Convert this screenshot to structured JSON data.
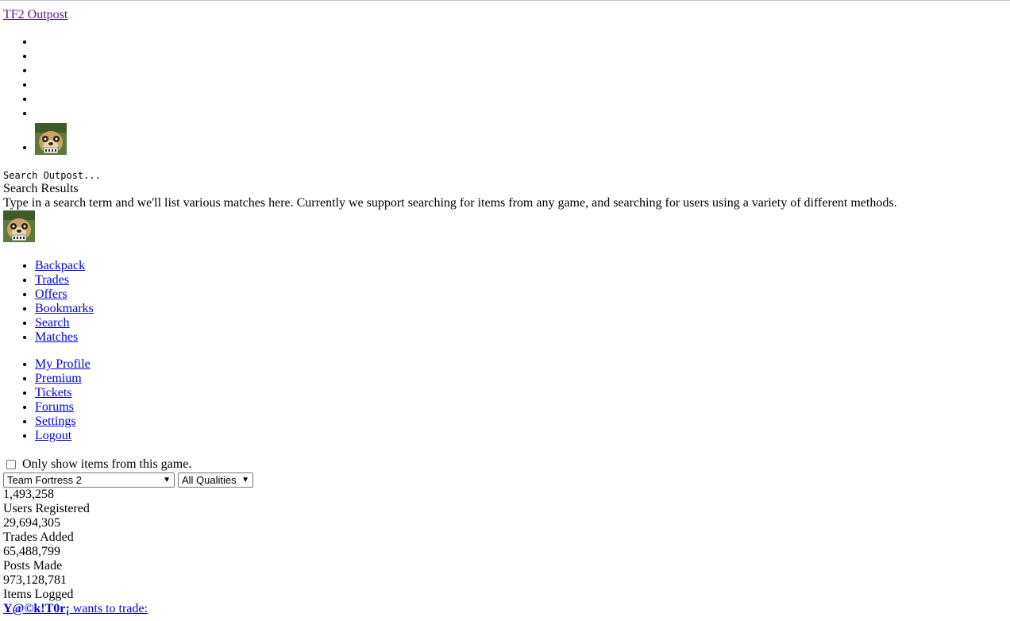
{
  "site": {
    "brand": "TF2 Outpost"
  },
  "search": {
    "label": "Search Outpost...",
    "results_title": "Search Results",
    "description": "Type in a search term and we'll list various matches here. Currently we support searching for items from any game, and searching for users using a variety of different methods."
  },
  "nav_main": [
    "Backpack",
    "Trades",
    "Offers",
    "Bookmarks",
    "Search",
    "Matches"
  ],
  "nav_account": [
    "My Profile",
    "Premium",
    "Tickets",
    "Forums",
    "Settings",
    "Logout"
  ],
  "filter": {
    "checkbox_label": "Only show items from this game.",
    "game_selected": "Team Fortress 2",
    "quality_selected": "All Qualities"
  },
  "stats": {
    "users_value": "1,493,258",
    "users_label": "Users Registered",
    "trades_value": "29,694,305",
    "trades_label": "Trades Added",
    "posts_value": "65,488,799",
    "posts_label": "Posts Made",
    "items_value": "973,128,781",
    "items_label": "Items Logged"
  },
  "trade": {
    "user": "Y@©k!T0r¡",
    "suffix": " wants to trade:"
  },
  "icons": {
    "avatar": "meerkat-avatar-icon"
  }
}
